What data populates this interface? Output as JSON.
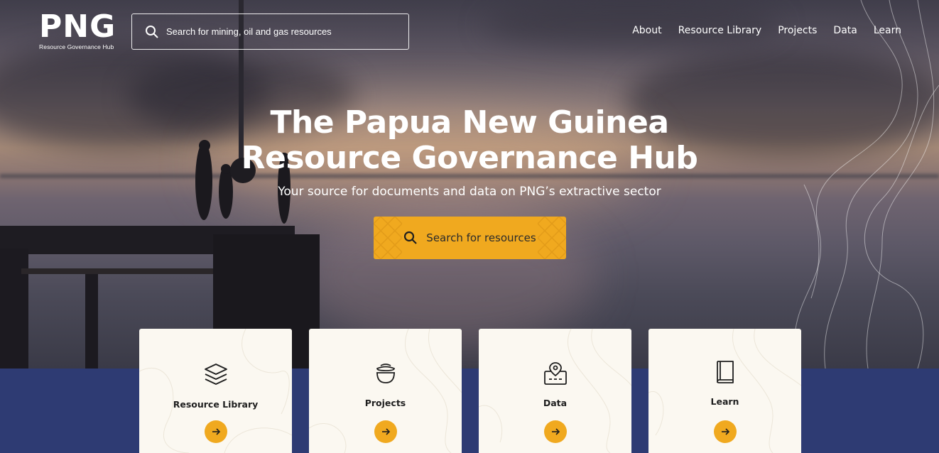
{
  "logo": {
    "main": "PNG",
    "sub": "Resource Governance Hub"
  },
  "search": {
    "placeholder": "Search for mining, oil and gas resources",
    "icon": "search-icon"
  },
  "nav": [
    {
      "label": "About"
    },
    {
      "label": "Resource Library"
    },
    {
      "label": "Projects"
    },
    {
      "label": "Data"
    },
    {
      "label": "Learn"
    }
  ],
  "hero": {
    "title_line1": "The Papua New Guinea",
    "title_line2": "Resource Governance Hub",
    "subtitle": "Your source for documents and data on PNG’s extractive sector",
    "cta_label": "Search for resources"
  },
  "cards": [
    {
      "label": "Resource Library",
      "icon": "layers-icon"
    },
    {
      "label": "Projects",
      "icon": "pot-icon"
    },
    {
      "label": "Data",
      "icon": "map-pin-icon"
    },
    {
      "label": "Learn",
      "icon": "book-icon"
    }
  ],
  "colors": {
    "accent": "#f0a91f",
    "band": "#2e3b73",
    "card_bg": "#fbf8f1"
  }
}
